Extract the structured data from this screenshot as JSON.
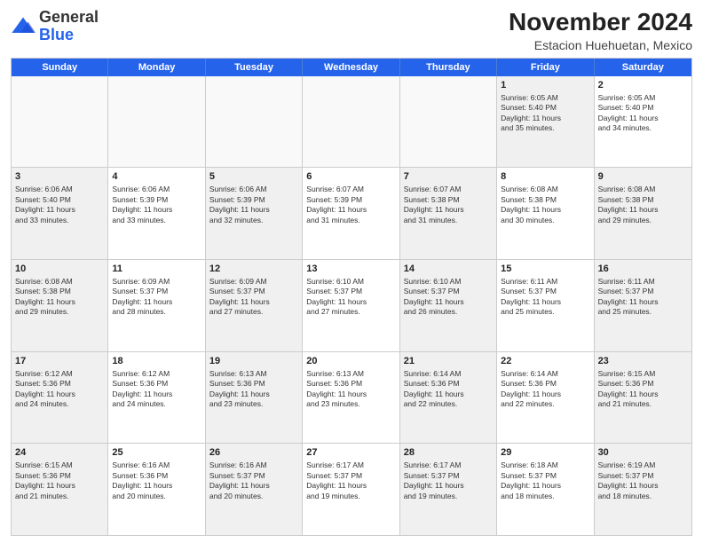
{
  "logo": {
    "general": "General",
    "blue": "Blue"
  },
  "header": {
    "month": "November 2024",
    "location": "Estacion Huehuetan, Mexico"
  },
  "weekdays": [
    "Sunday",
    "Monday",
    "Tuesday",
    "Wednesday",
    "Thursday",
    "Friday",
    "Saturday"
  ],
  "rows": [
    [
      {
        "day": "",
        "lines": [],
        "empty": true
      },
      {
        "day": "",
        "lines": [],
        "empty": true
      },
      {
        "day": "",
        "lines": [],
        "empty": true
      },
      {
        "day": "",
        "lines": [],
        "empty": true
      },
      {
        "day": "",
        "lines": [],
        "empty": true
      },
      {
        "day": "1",
        "lines": [
          "Sunrise: 6:05 AM",
          "Sunset: 5:40 PM",
          "Daylight: 11 hours",
          "and 35 minutes."
        ],
        "empty": false,
        "shaded": true
      },
      {
        "day": "2",
        "lines": [
          "Sunrise: 6:05 AM",
          "Sunset: 5:40 PM",
          "Daylight: 11 hours",
          "and 34 minutes."
        ],
        "empty": false,
        "shaded": false
      }
    ],
    [
      {
        "day": "3",
        "lines": [
          "Sunrise: 6:06 AM",
          "Sunset: 5:40 PM",
          "Daylight: 11 hours",
          "and 33 minutes."
        ],
        "shaded": true
      },
      {
        "day": "4",
        "lines": [
          "Sunrise: 6:06 AM",
          "Sunset: 5:39 PM",
          "Daylight: 11 hours",
          "and 33 minutes."
        ],
        "shaded": false
      },
      {
        "day": "5",
        "lines": [
          "Sunrise: 6:06 AM",
          "Sunset: 5:39 PM",
          "Daylight: 11 hours",
          "and 32 minutes."
        ],
        "shaded": true
      },
      {
        "day": "6",
        "lines": [
          "Sunrise: 6:07 AM",
          "Sunset: 5:39 PM",
          "Daylight: 11 hours",
          "and 31 minutes."
        ],
        "shaded": false
      },
      {
        "day": "7",
        "lines": [
          "Sunrise: 6:07 AM",
          "Sunset: 5:38 PM",
          "Daylight: 11 hours",
          "and 31 minutes."
        ],
        "shaded": true
      },
      {
        "day": "8",
        "lines": [
          "Sunrise: 6:08 AM",
          "Sunset: 5:38 PM",
          "Daylight: 11 hours",
          "and 30 minutes."
        ],
        "shaded": false
      },
      {
        "day": "9",
        "lines": [
          "Sunrise: 6:08 AM",
          "Sunset: 5:38 PM",
          "Daylight: 11 hours",
          "and 29 minutes."
        ],
        "shaded": true
      }
    ],
    [
      {
        "day": "10",
        "lines": [
          "Sunrise: 6:08 AM",
          "Sunset: 5:38 PM",
          "Daylight: 11 hours",
          "and 29 minutes."
        ],
        "shaded": true
      },
      {
        "day": "11",
        "lines": [
          "Sunrise: 6:09 AM",
          "Sunset: 5:37 PM",
          "Daylight: 11 hours",
          "and 28 minutes."
        ],
        "shaded": false
      },
      {
        "day": "12",
        "lines": [
          "Sunrise: 6:09 AM",
          "Sunset: 5:37 PM",
          "Daylight: 11 hours",
          "and 27 minutes."
        ],
        "shaded": true
      },
      {
        "day": "13",
        "lines": [
          "Sunrise: 6:10 AM",
          "Sunset: 5:37 PM",
          "Daylight: 11 hours",
          "and 27 minutes."
        ],
        "shaded": false
      },
      {
        "day": "14",
        "lines": [
          "Sunrise: 6:10 AM",
          "Sunset: 5:37 PM",
          "Daylight: 11 hours",
          "and 26 minutes."
        ],
        "shaded": true
      },
      {
        "day": "15",
        "lines": [
          "Sunrise: 6:11 AM",
          "Sunset: 5:37 PM",
          "Daylight: 11 hours",
          "and 25 minutes."
        ],
        "shaded": false
      },
      {
        "day": "16",
        "lines": [
          "Sunrise: 6:11 AM",
          "Sunset: 5:37 PM",
          "Daylight: 11 hours",
          "and 25 minutes."
        ],
        "shaded": true
      }
    ],
    [
      {
        "day": "17",
        "lines": [
          "Sunrise: 6:12 AM",
          "Sunset: 5:36 PM",
          "Daylight: 11 hours",
          "and 24 minutes."
        ],
        "shaded": true
      },
      {
        "day": "18",
        "lines": [
          "Sunrise: 6:12 AM",
          "Sunset: 5:36 PM",
          "Daylight: 11 hours",
          "and 24 minutes."
        ],
        "shaded": false
      },
      {
        "day": "19",
        "lines": [
          "Sunrise: 6:13 AM",
          "Sunset: 5:36 PM",
          "Daylight: 11 hours",
          "and 23 minutes."
        ],
        "shaded": true
      },
      {
        "day": "20",
        "lines": [
          "Sunrise: 6:13 AM",
          "Sunset: 5:36 PM",
          "Daylight: 11 hours",
          "and 23 minutes."
        ],
        "shaded": false
      },
      {
        "day": "21",
        "lines": [
          "Sunrise: 6:14 AM",
          "Sunset: 5:36 PM",
          "Daylight: 11 hours",
          "and 22 minutes."
        ],
        "shaded": true
      },
      {
        "day": "22",
        "lines": [
          "Sunrise: 6:14 AM",
          "Sunset: 5:36 PM",
          "Daylight: 11 hours",
          "and 22 minutes."
        ],
        "shaded": false
      },
      {
        "day": "23",
        "lines": [
          "Sunrise: 6:15 AM",
          "Sunset: 5:36 PM",
          "Daylight: 11 hours",
          "and 21 minutes."
        ],
        "shaded": true
      }
    ],
    [
      {
        "day": "24",
        "lines": [
          "Sunrise: 6:15 AM",
          "Sunset: 5:36 PM",
          "Daylight: 11 hours",
          "and 21 minutes."
        ],
        "shaded": true
      },
      {
        "day": "25",
        "lines": [
          "Sunrise: 6:16 AM",
          "Sunset: 5:36 PM",
          "Daylight: 11 hours",
          "and 20 minutes."
        ],
        "shaded": false
      },
      {
        "day": "26",
        "lines": [
          "Sunrise: 6:16 AM",
          "Sunset: 5:37 PM",
          "Daylight: 11 hours",
          "and 20 minutes."
        ],
        "shaded": true
      },
      {
        "day": "27",
        "lines": [
          "Sunrise: 6:17 AM",
          "Sunset: 5:37 PM",
          "Daylight: 11 hours",
          "and 19 minutes."
        ],
        "shaded": false
      },
      {
        "day": "28",
        "lines": [
          "Sunrise: 6:17 AM",
          "Sunset: 5:37 PM",
          "Daylight: 11 hours",
          "and 19 minutes."
        ],
        "shaded": true
      },
      {
        "day": "29",
        "lines": [
          "Sunrise: 6:18 AM",
          "Sunset: 5:37 PM",
          "Daylight: 11 hours",
          "and 18 minutes."
        ],
        "shaded": false
      },
      {
        "day": "30",
        "lines": [
          "Sunrise: 6:19 AM",
          "Sunset: 5:37 PM",
          "Daylight: 11 hours",
          "and 18 minutes."
        ],
        "shaded": true
      }
    ]
  ]
}
